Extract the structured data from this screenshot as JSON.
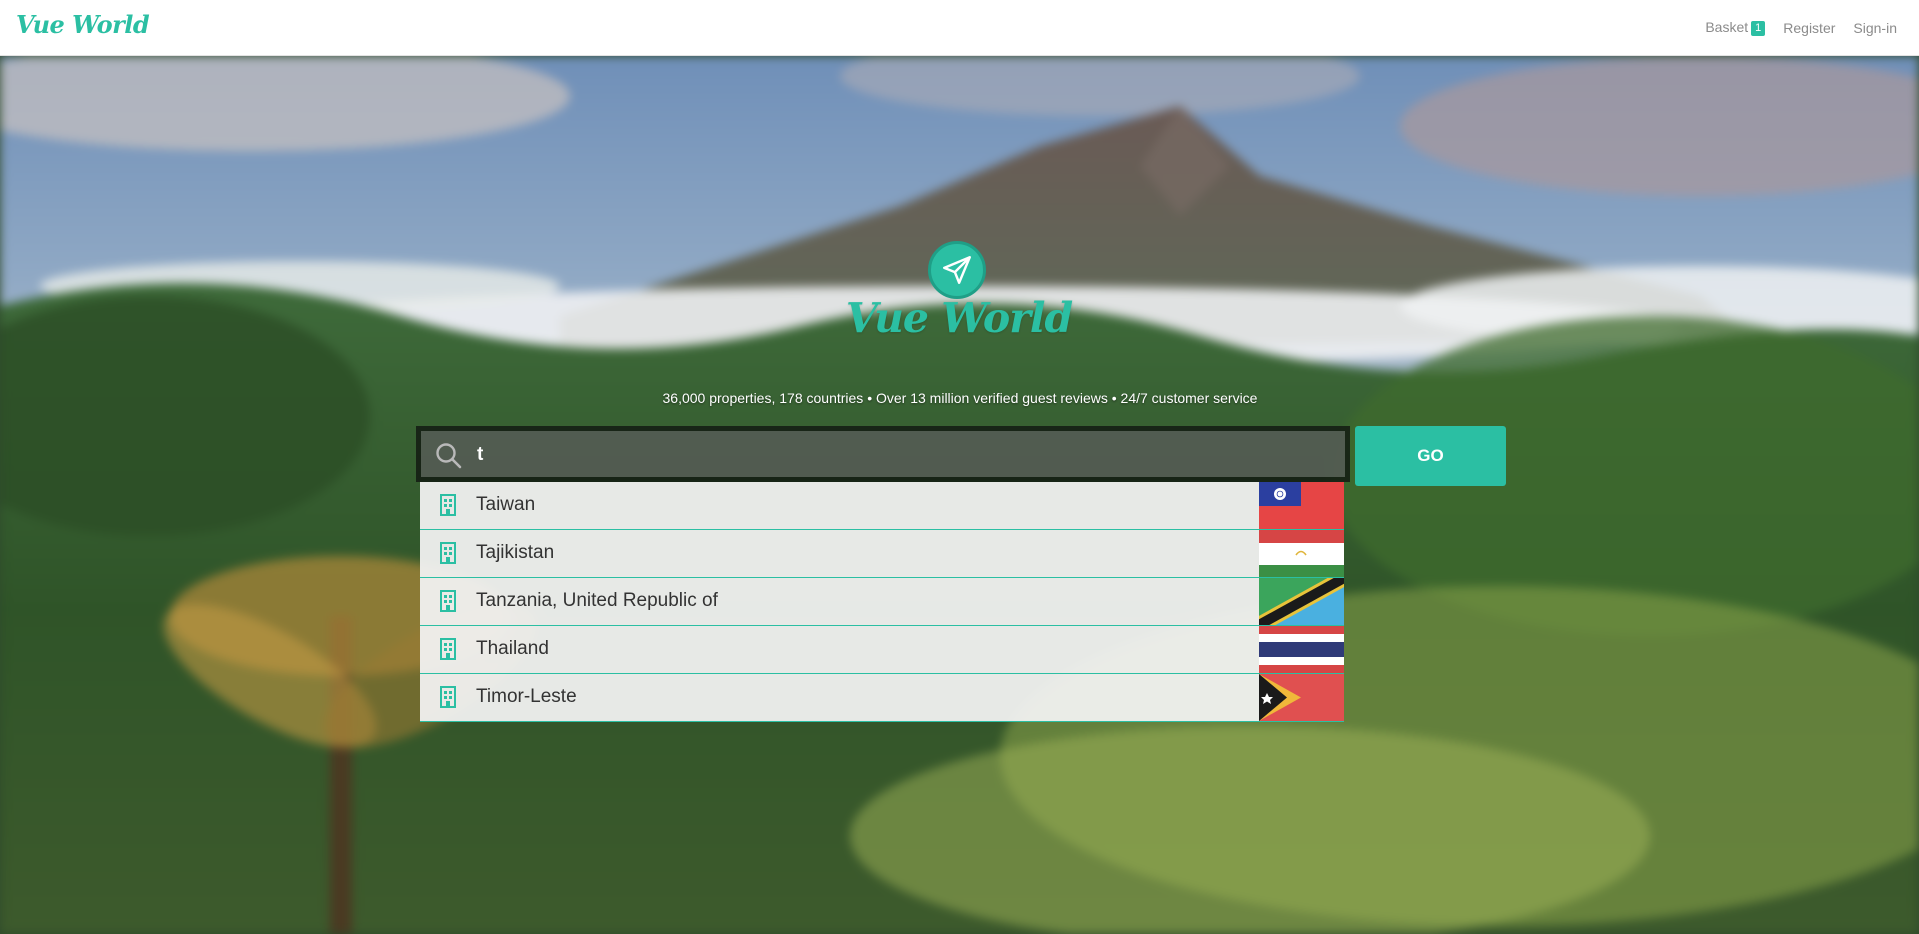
{
  "header": {
    "brand": "Vue World",
    "nav": {
      "basket": "Basket",
      "basket_count": "1",
      "register": "Register",
      "signin": "Sign-in"
    }
  },
  "hero": {
    "logo_text": "Vue World",
    "tagline": "36,000 properties, 178 countries • Over 13 million verified guest reviews • 24/7 customer service"
  },
  "search": {
    "value": "t",
    "go_label": "GO"
  },
  "suggestions": [
    {
      "label": "Taiwan",
      "flag": "taiwan-flag"
    },
    {
      "label": "Tajikistan",
      "flag": "tajikistan-flag"
    },
    {
      "label": "Tanzania, United Republic of",
      "flag": "tanzania-flag"
    },
    {
      "label": "Thailand",
      "flag": "thailand-flag"
    },
    {
      "label": "Timor-Leste",
      "flag": "timor-leste-flag"
    }
  ],
  "colors": {
    "accent": "#2bbfa3",
    "nav_text": "#8b8b8b"
  }
}
